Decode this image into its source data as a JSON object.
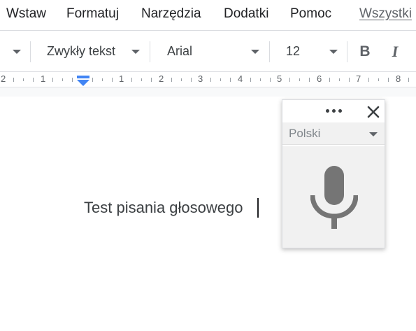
{
  "menubar": {
    "items": [
      "Wstaw",
      "Formatuj",
      "Narzędzia",
      "Dodatki",
      "Pomoc"
    ],
    "link": "Wszystki"
  },
  "toolbar": {
    "style": "Zwykły tekst",
    "font": "Arial",
    "size": "12",
    "bold_label": "B",
    "italic_label": "I"
  },
  "ruler": {
    "numbers": [
      "2",
      "1",
      "1",
      "2",
      "3",
      "4",
      "5",
      "6",
      "7",
      "8"
    ]
  },
  "document": {
    "text": "Test pisania głosowego"
  },
  "voice_panel": {
    "language": "Polski",
    "icons": [
      "more-icon",
      "close-icon",
      "microphone-icon"
    ]
  },
  "colors": {
    "accent": "#4285f4",
    "mic": "#757575",
    "panel_bg": "#f1f1f1"
  }
}
